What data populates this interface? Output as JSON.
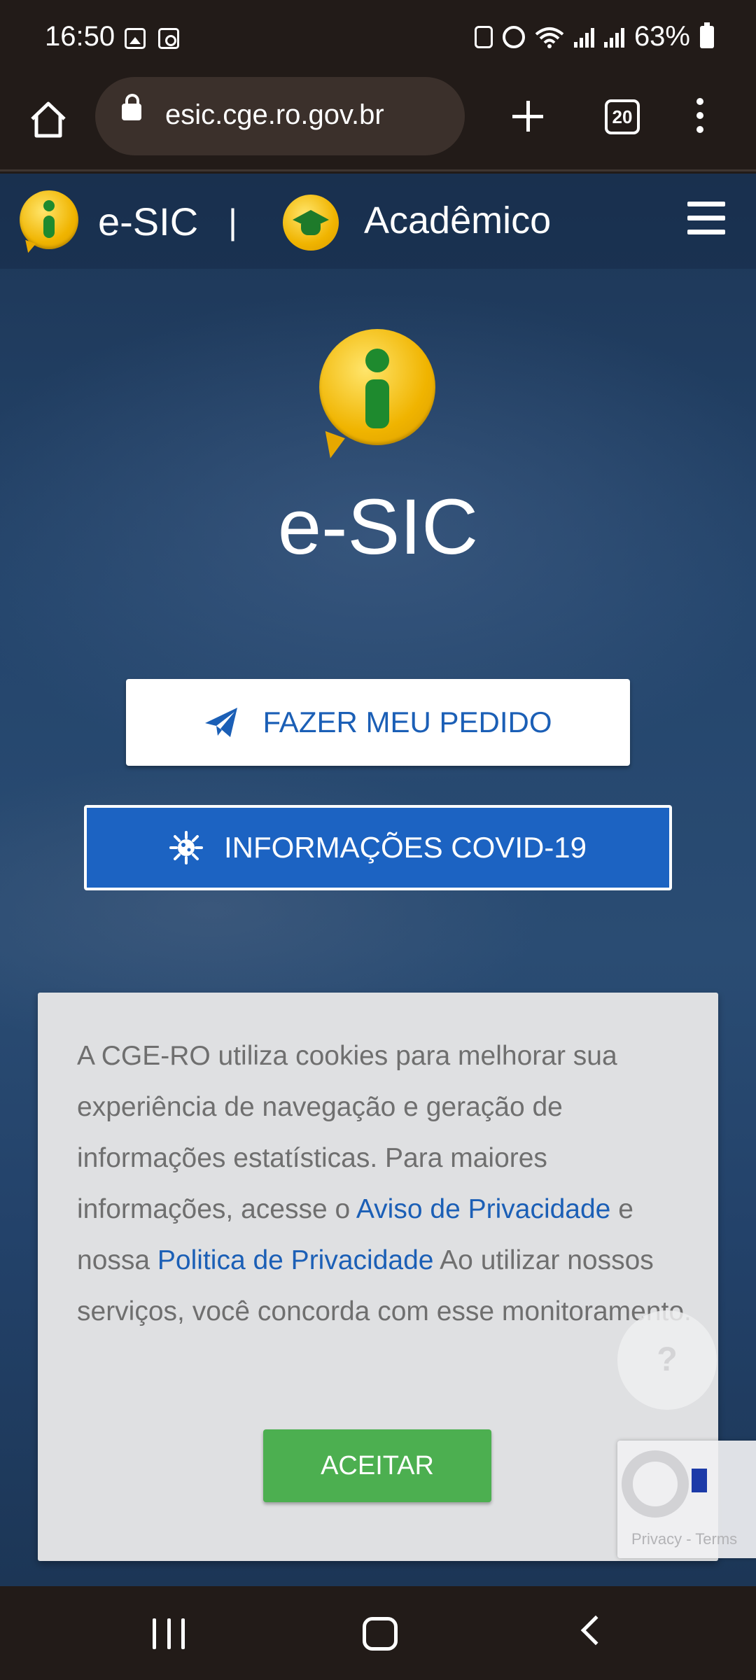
{
  "status_bar": {
    "time": "16:50",
    "battery": "63%"
  },
  "browser": {
    "url": "esic.cge.ro.gov.br",
    "tab_count": "20"
  },
  "site_header": {
    "brand_prefix": "e-",
    "brand_suffix": "SIC",
    "separator": "|",
    "academic_label": "Acadêmico"
  },
  "hero": {
    "title_prefix": "e-",
    "title_suffix": "SIC"
  },
  "buttons": {
    "pedido_label": "FAZER MEU PEDIDO",
    "covid_label": "INFORMAÇÕES COVID-19"
  },
  "cookie_banner": {
    "text_part1": "A CGE-RO utiliza cookies para melhorar sua experiência de navegação e geração de informações estatísticas. Para maiores informações, acesse o ",
    "link_aviso": "Aviso de Privacidade",
    "text_part2": " e nossa ",
    "link_politica": "Politica de Privacidade",
    "text_part3": " Ao utilizar nossos serviços, você concorda com esse monitoramento.",
    "accept_label": "ACEITAR"
  },
  "help_bubble": {
    "label": "?"
  },
  "recaptcha": {
    "links": "Privacy - Terms"
  },
  "colors": {
    "primary_blue": "#1c63c2",
    "accept_green": "#4caf50",
    "link_blue": "#1b5fb6"
  },
  "icons": {
    "status_left": [
      "gallery-icon",
      "clock-app-icon"
    ],
    "status_right": [
      "lock-app-icon",
      "alarm-icon",
      "wifi-icon",
      "signal-icon",
      "battery-icon"
    ],
    "browser": [
      "home-icon",
      "lock-icon",
      "plus-icon",
      "tabs-icon",
      "more-vert-icon"
    ],
    "page": [
      "info-logo-icon",
      "graduation-cap-icon",
      "hamburger-menu-icon",
      "paper-plane-icon",
      "virus-icon",
      "help-icon",
      "recaptcha-icon"
    ],
    "nav": [
      "recents-icon",
      "home-nav-icon",
      "back-icon"
    ]
  }
}
